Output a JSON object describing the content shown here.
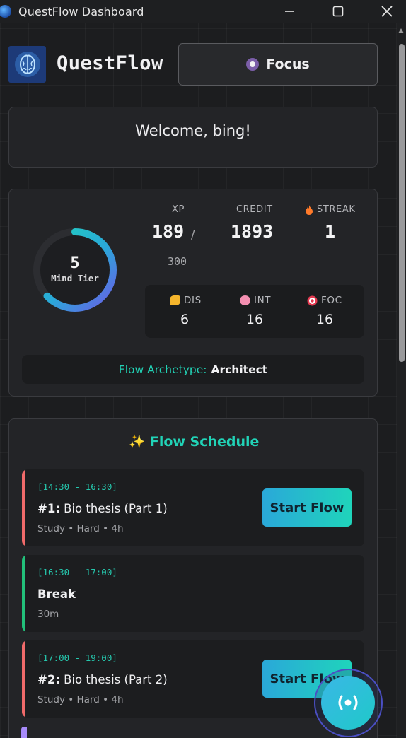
{
  "window": {
    "title": "QuestFlow Dashboard"
  },
  "header": {
    "brand": "QuestFlow",
    "focus_label": "Focus"
  },
  "welcome": {
    "text": "Welcome, bing!"
  },
  "stats": {
    "tier_number": "5",
    "tier_label": "Mind Tier",
    "tier_progress": 0.63,
    "xp_label": "XP",
    "xp_value": "189",
    "xp_sep": "/",
    "xp_max": "300",
    "credit_label": "CREDIT",
    "credit_value": "1893",
    "streak_label": "STREAK",
    "streak_value": "1",
    "attributes": [
      {
        "label": "DIS",
        "value": "6",
        "icon": "flexed-biceps-icon"
      },
      {
        "label": "INT",
        "value": "16",
        "icon": "brain-icon"
      },
      {
        "label": "FOC",
        "value": "16",
        "icon": "target-icon"
      }
    ],
    "archetype_label": "Flow Archetype:",
    "archetype_value": "Architect"
  },
  "schedule": {
    "title": "✨ Flow Schedule",
    "items": [
      {
        "time": "[14:30 - 16:30]",
        "number": "#1:",
        "name": "Bio thesis (Part 1)",
        "meta": "Study • Hard • 4h",
        "button": "Start Flow",
        "accent": "#f06a6a"
      },
      {
        "time": "[16:30 - 17:00]",
        "number": "",
        "name": "Break",
        "meta": "30m",
        "button": "",
        "accent": "#22c07a"
      },
      {
        "time": "[17:00 - 19:00]",
        "number": "#2:",
        "name": "Bio thesis (Part 2)",
        "meta": "Study • Hard • 4h",
        "button": "Start Flow",
        "accent": "#f06a6a"
      }
    ]
  },
  "colors": {
    "accent": "#21d3b7",
    "ring_start": "#1fd4bb",
    "ring_end": "#6b5ce7"
  }
}
